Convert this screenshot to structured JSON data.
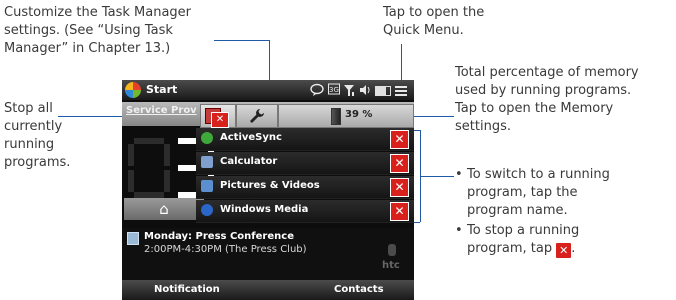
{
  "callouts": {
    "customize_lines": [
      "Customize the Task Manager",
      "settings. (See “Using Task",
      "Manager” in Chapter 13.)"
    ],
    "quick_menu_lines": [
      "Tap to open the",
      "Quick Menu."
    ],
    "memory_lines": [
      "Total percentage of memory",
      "used by running programs.",
      "Tap to open the Memory",
      "settings."
    ],
    "stop_all_lines": [
      "Stop all",
      "currently",
      "running",
      "programs."
    ],
    "bullets": [
      [
        "To switch to a running",
        "program, tap the",
        "program name."
      ],
      [
        "To stop a running",
        "program, tap"
      ]
    ],
    "inline_stop_glyph": "✕"
  },
  "device": {
    "start_label": "Start",
    "tab_label": "Service Prov",
    "settings_icon": "wrench-icon",
    "memory_percent": "39 %",
    "clock_digits": "03",
    "programs": [
      {
        "name": "ActiveSync",
        "icon": "activesync-icon",
        "color": "#3fa83a"
      },
      {
        "name": "Calculator",
        "icon": "calculator-icon",
        "color": "#7f9fcf"
      },
      {
        "name": "Pictures & Videos",
        "icon": "pictures-icon",
        "color": "#5b8fd0"
      },
      {
        "name": "Windows Media",
        "icon": "windows-media-icon",
        "color": "#2a67c9"
      }
    ],
    "kill_glyph": "✕",
    "home_glyph": "⌂",
    "appointment": {
      "title": "Monday: Press Conference",
      "time": "2:00PM-4:30PM (The Press Club)"
    },
    "brand": "htc",
    "softkey_left": "Notification",
    "softkey_right": "Contacts"
  },
  "colors": {
    "callout_line": "#1e5aa8",
    "stop_red": "#d8201c"
  }
}
